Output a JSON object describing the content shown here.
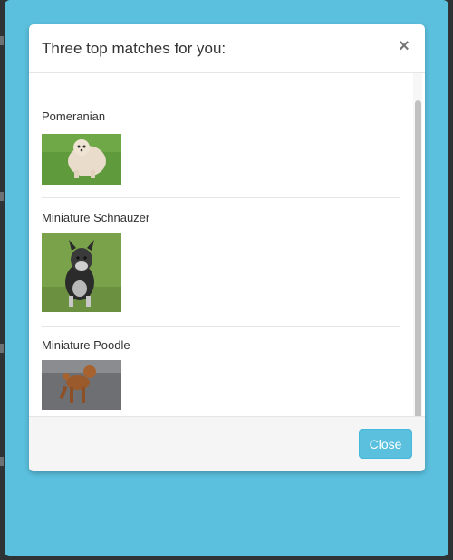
{
  "modal": {
    "title": "Three top matches for you:",
    "close_icon": "close-icon",
    "close_glyph": "×",
    "close_button_label": "Close"
  },
  "matches": [
    {
      "name": "Pomeranian",
      "photo": "dog-photo-pomeranian"
    },
    {
      "name": "Miniature Schnauzer",
      "photo": "dog-photo-miniature-schnauzer"
    },
    {
      "name": "Miniature Poodle",
      "photo": "dog-photo-miniature-poodle"
    }
  ],
  "colors": {
    "backdrop": "#5bc0de",
    "button": "#5bc0de",
    "page": "#2e3336"
  }
}
